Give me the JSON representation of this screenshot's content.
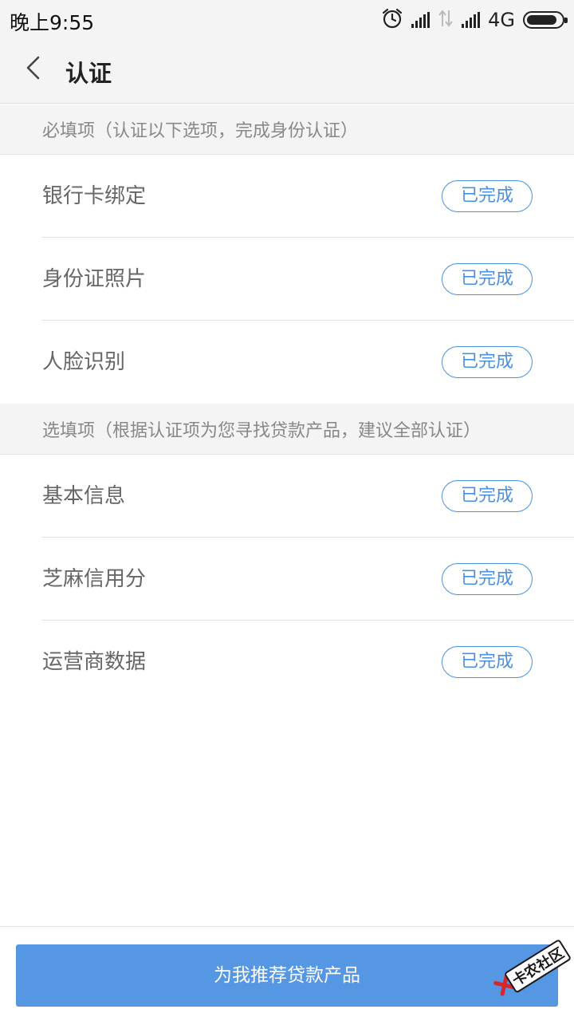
{
  "status_bar": {
    "time": "晚上9:55",
    "network": "4G",
    "icons": [
      "alarm-icon",
      "signal-icon",
      "data-arrows-icon",
      "signal-icon",
      "battery-icon"
    ]
  },
  "nav": {
    "title": "认证",
    "back_icon": "chevron-left-icon"
  },
  "required_section": {
    "header": "必填项（认证以下选项，完成身份认证）",
    "items": [
      {
        "label": "银行卡绑定",
        "status": "已完成"
      },
      {
        "label": "身份证照片",
        "status": "已完成"
      },
      {
        "label": "人脸识别",
        "status": "已完成"
      }
    ]
  },
  "optional_section": {
    "header": "选填项（根据认证项为您寻找贷款产品，建议全部认证）",
    "items": [
      {
        "label": "基本信息",
        "status": "已完成"
      },
      {
        "label": "芝麻信用分",
        "status": "已完成"
      },
      {
        "label": "运营商数据",
        "status": "已完成"
      }
    ]
  },
  "footer": {
    "button_label": "为我推荐贷款产品"
  },
  "watermark": {
    "text": "卡农社区"
  },
  "colors": {
    "accent": "#4a90e2",
    "button": "#5597e3",
    "header_bg": "#f4f4f4"
  }
}
